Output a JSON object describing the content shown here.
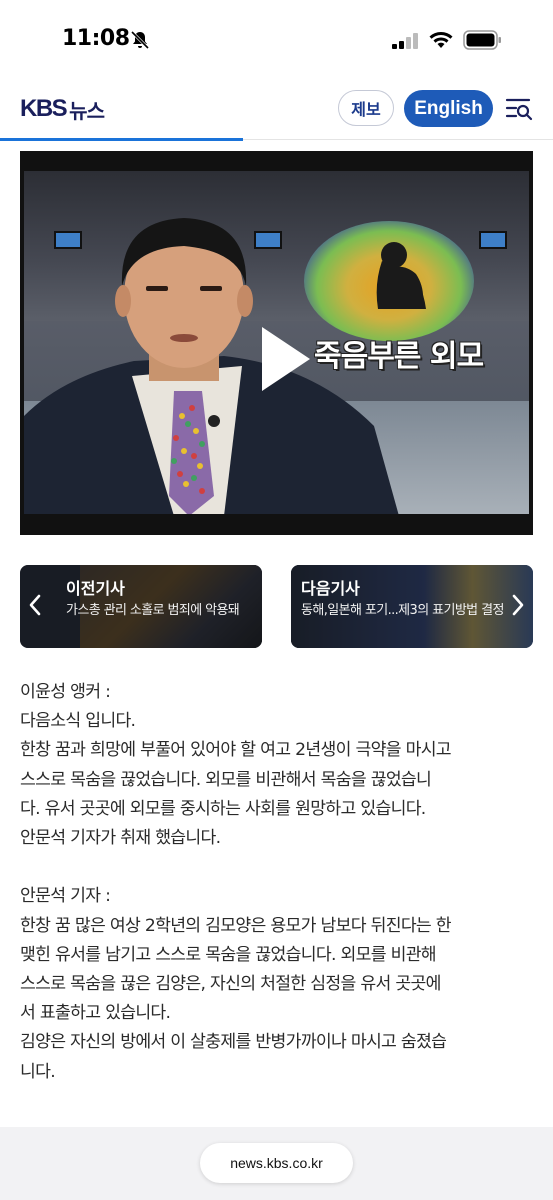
{
  "status_bar": {
    "time": "11:08",
    "icons": [
      "bell-slash-icon",
      "signal-icon",
      "wifi-icon",
      "battery-icon"
    ]
  },
  "header": {
    "logo_kbs": "KBS",
    "logo_news": "뉴스",
    "report_label": "제보",
    "english_label": "English",
    "menu_icon": "menu-search-icon",
    "accent_color": "#1e5bb8",
    "brand_color": "#1a1f5c"
  },
  "video": {
    "graphic_caption": "죽음부른 외모",
    "play_icon": "play-icon"
  },
  "article_nav": {
    "prev": {
      "title": "이전기사",
      "desc": "가스총 관리 소홀로 범죄에 악용돼"
    },
    "next": {
      "title": "다음기사",
      "desc": "동해,일본해 포기...제3의 표기방법 결정"
    }
  },
  "article": {
    "lines_1": [
      "이윤성 앵커 :",
      "다음소식 입니다.",
      "한창 꿈과 희망에 부풀어 있어야 할 여고 2년생이 극약을 마시고",
      "스스로 목숨을 끊었습니다. 외모를 비관해서 목숨을 끊었습니",
      "다. 유서 곳곳에 외모를 중시하는 사회를 원망하고 있습니다.",
      "안문석 기자가 취재 했습니다."
    ],
    "lines_2": [
      "안문석 기자 :",
      "한창 꿈 많은 여상 2학년의 김모양은 용모가 남보다 뒤진다는 한",
      "맺힌 유서를 남기고 스스로 목숨을 끊었습니다. 외모를 비관해",
      "스스로 목숨을 끊은 김양은, 자신의 처절한 심정을 유서 곳곳에",
      "서 표출하고 있습니다.",
      "김양은 자신의 방에서 이 살충제를 반병가까이나 마시고 숨졌습",
      "니다."
    ]
  },
  "browser": {
    "url": "news.kbs.co.kr"
  }
}
